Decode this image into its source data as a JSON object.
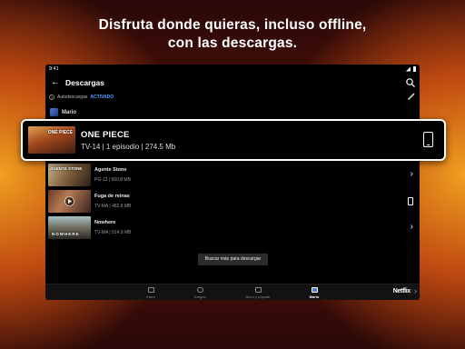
{
  "headline": {
    "line1": "Disfruta donde quieras, incluso offline,",
    "line2": "con las descargas."
  },
  "statusbar": {
    "time": "9:41"
  },
  "appbar": {
    "title": "Descargas"
  },
  "smart_downloads": {
    "label": "Autodescargas",
    "state": "ACTIVADO"
  },
  "profile": {
    "name": "Mario"
  },
  "featured": {
    "title": "ONE PIECE",
    "subtitle": "TV-14 | 1 episodio | 274.5 Mb",
    "thumb_text": "ONE PIECE"
  },
  "items": [
    {
      "title": "Agente Stone",
      "meta": "PG-13 | 660.8 MB",
      "thumb_text": "AGENTE STONE",
      "action": "chevron-right-icon"
    },
    {
      "title": "Fuga de reinas",
      "meta": "TV-MA | 482.8 MB",
      "thumb_text": "",
      "action": "device-icon"
    },
    {
      "title": "Nowhere",
      "meta": "TV-MA | 514.9 MB",
      "thumb_text": "NOWHERE",
      "action": "chevron-right-icon"
    }
  ],
  "find_more": {
    "label": "Buscar más para descargar"
  },
  "bottom_nav": [
    {
      "label": "Inicio",
      "active": false
    },
    {
      "label": "Juegos",
      "active": false
    },
    {
      "label": "Novo y popular",
      "active": false
    },
    {
      "label": "Mario",
      "active": true
    }
  ],
  "logo_text": "Netflix",
  "colors": {
    "accent_blue": "#4aa3ff",
    "background": "#000000",
    "glow": "#f0a020"
  }
}
